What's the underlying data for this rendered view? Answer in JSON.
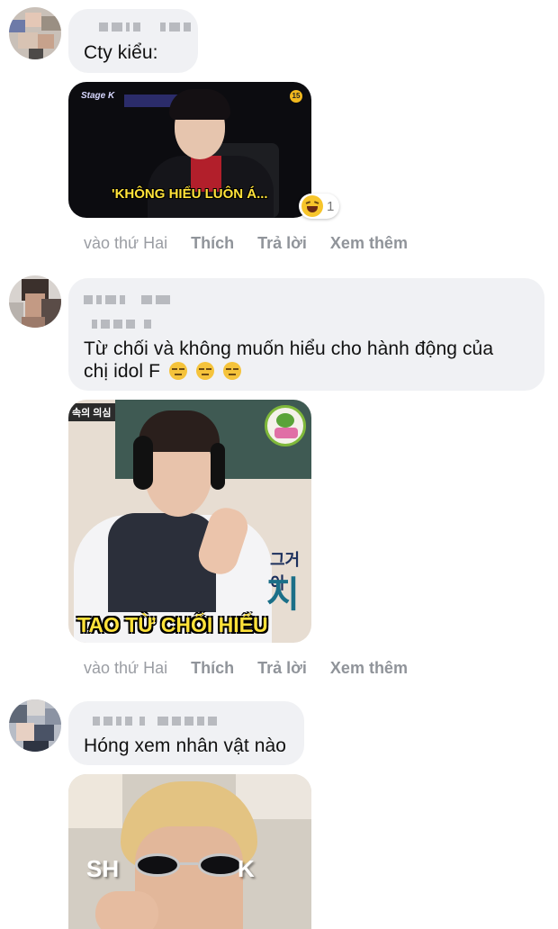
{
  "comments": [
    {
      "text": "Cty kiểu:",
      "sticker_caption": "'KHÔNG HIỂU LUÔN Á...",
      "sticker_logo": "Stage K",
      "sticker_badge": "15",
      "reaction_count": "1",
      "actions": {
        "time": "vào thứ Hai",
        "like": "Thích",
        "reply": "Trả lời",
        "more": "Xem thêm"
      }
    },
    {
      "text_line1": "Từ chối và không muốn hiểu cho hành động của",
      "text_line2": "chị idol F",
      "sticker_caption": "TAO TỪ CHỐI HIỂU",
      "sticker_korean1": "그거이",
      "sticker_korean2": "지",
      "sticker_corner": "속의 의심",
      "actions": {
        "time": "vào thứ Hai",
        "like": "Thích",
        "reply": "Trả lời",
        "more": "Xem thêm"
      }
    },
    {
      "text": "Hóng xem nhân vật nào",
      "sticker_caption_left": "SH",
      "sticker_caption_right": "K"
    }
  ],
  "colors": {
    "bubble": "#f0f1f4",
    "caption_yellow": "#ffe23a",
    "action_text": "#90949a"
  }
}
